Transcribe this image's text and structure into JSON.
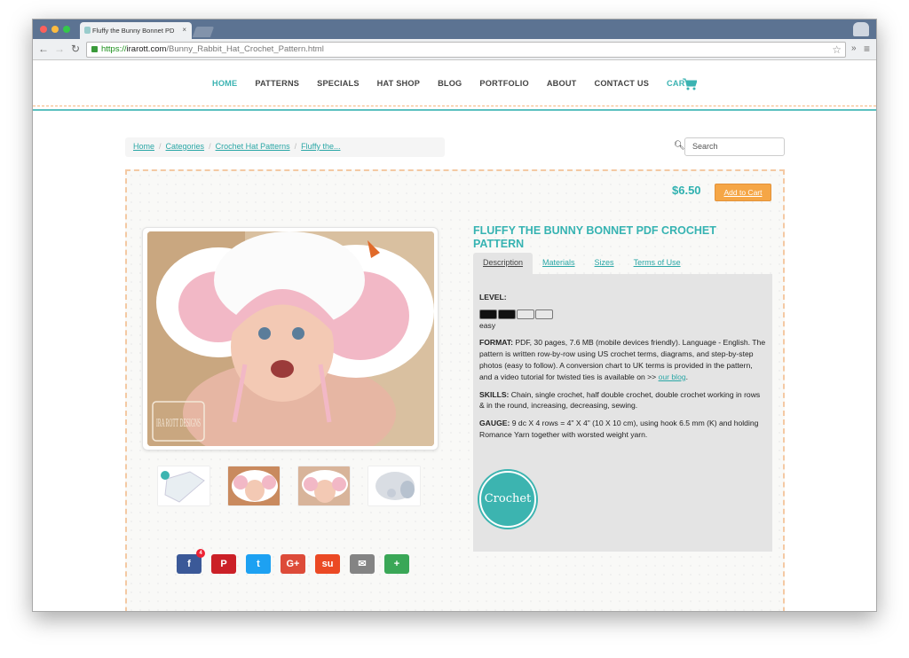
{
  "browser": {
    "tab_title": "Fluffy the Bunny Bonnet PD",
    "url_scheme": "https://",
    "url_host": "irarott.com",
    "url_path": "/Bunny_Rabbit_Hat_Crochet_Pattern.html",
    "icons": {
      "back": "back-arrow-icon",
      "forward": "forward-arrow-icon",
      "reload": "reload-icon",
      "bookmark": "star-icon",
      "menu": "hamburger-menu-icon"
    }
  },
  "menu": {
    "items": [
      {
        "label": "HOME"
      },
      {
        "label": "PATTERNS"
      },
      {
        "label": "SPECIALS"
      },
      {
        "label": "HAT SHOP"
      },
      {
        "label": "BLOG"
      },
      {
        "label": "PORTFOLIO"
      },
      {
        "label": "ABOUT"
      },
      {
        "label": "CONTACT US"
      },
      {
        "label": "CART"
      }
    ],
    "accent_color": "#3bb3b2"
  },
  "breadcrumb": {
    "items": [
      {
        "label": "Home"
      },
      {
        "label": "Categories"
      },
      {
        "label": "Crochet Hat Patterns"
      },
      {
        "label": "Fluffy the..."
      }
    ],
    "separator": "/"
  },
  "search": {
    "placeholder": "Search"
  },
  "product": {
    "price": "$6.50",
    "add_to_cart": "Add to Cart",
    "title": "FLUFFY THE BUNNY BONNET PDF CROCHET PATTERN",
    "tabs": [
      {
        "label": "Description"
      },
      {
        "label": "Materials"
      },
      {
        "label": "Sizes"
      },
      {
        "label": "Terms of Use"
      }
    ],
    "level_label": "LEVEL:",
    "level_value": "easy",
    "level_filled": 2,
    "level_total": 4,
    "format_label": "FORMAT:",
    "format_text": " PDF, 30 pages, 7.6 MB (mobile devices friendly). Language - English. The pattern is written row-by-row using US crochet terms, diagrams, and step-by-step photos (easy to follow). A conversion chart to UK terms is provided in the pattern, and a video tutorial for twisted ties is available on >> ",
    "format_link": "our blog",
    "format_end": ".",
    "skills_label": "SKILLS:",
    "skills_text": " Chain, single crochet, half double crochet, double crochet working in rows & in the round, increasing, decreasing, sewing.",
    "gauge_label": "GAUGE:",
    "gauge_text": " 9 dc X 4 rows = 4\" X 4\" (10 X 10 cm), using hook 6.5 mm (K) and holding Romance Yarn together with worsted weight yarn.",
    "badge_text": "Crochet",
    "image_watermark": "IRA ROTT DESIGNS"
  },
  "social": {
    "buttons": [
      {
        "name": "facebook-icon",
        "label": "f",
        "color": "#3b5998",
        "count": "4"
      },
      {
        "name": "pinterest-icon",
        "label": "P",
        "color": "#cb2027"
      },
      {
        "name": "twitter-icon",
        "label": "t",
        "color": "#1da1f2"
      },
      {
        "name": "google-plus-icon",
        "label": "G+",
        "color": "#dd4b39"
      },
      {
        "name": "stumbleupon-icon",
        "label": "su",
        "color": "#eb4924"
      },
      {
        "name": "email-icon",
        "label": "✉",
        "color": "#848484"
      },
      {
        "name": "share-icon",
        "label": "+",
        "color": "#3aa757"
      }
    ]
  }
}
